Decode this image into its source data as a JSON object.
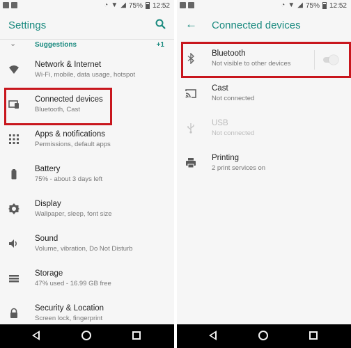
{
  "left": {
    "status": {
      "battery": "75%",
      "time": "12:52"
    },
    "title": "Settings",
    "suggestions": {
      "label": "Suggestions",
      "count": "+1"
    },
    "items": [
      {
        "title": "Network & Internet",
        "subtitle": "Wi-Fi, mobile, data usage, hotspot",
        "icon": "wifi-icon"
      },
      {
        "title": "Connected devices",
        "subtitle": "Bluetooth, Cast",
        "icon": "connected-devices-icon"
      },
      {
        "title": "Apps & notifications",
        "subtitle": "Permissions, default apps",
        "icon": "apps-grid-icon"
      },
      {
        "title": "Battery",
        "subtitle": "75% - about 3 days left",
        "icon": "battery-icon"
      },
      {
        "title": "Display",
        "subtitle": "Wallpaper, sleep, font size",
        "icon": "brightness-icon"
      },
      {
        "title": "Sound",
        "subtitle": "Volume, vibration, Do Not Disturb",
        "icon": "volume-icon"
      },
      {
        "title": "Storage",
        "subtitle": "47% used - 16.99 GB free",
        "icon": "storage-icon"
      },
      {
        "title": "Security & Location",
        "subtitle": "Screen lock, fingerprint",
        "icon": "lock-icon"
      }
    ]
  },
  "right": {
    "status": {
      "battery": "75%",
      "time": "12:52"
    },
    "title": "Connected devices",
    "items": [
      {
        "title": "Bluetooth",
        "subtitle": "Not visible to other devices",
        "icon": "bluetooth-icon",
        "toggle": false
      },
      {
        "title": "Cast",
        "subtitle": "Not connected",
        "icon": "cast-icon"
      },
      {
        "title": "USB",
        "subtitle": "Not connected",
        "icon": "usb-icon",
        "disabled": true
      },
      {
        "title": "Printing",
        "subtitle": "2 print services on",
        "icon": "print-icon"
      }
    ]
  },
  "colors": {
    "accent": "#1a8a7f",
    "highlight": "#c8161d",
    "background": "#f6f6f6",
    "navbar": "#000000"
  }
}
